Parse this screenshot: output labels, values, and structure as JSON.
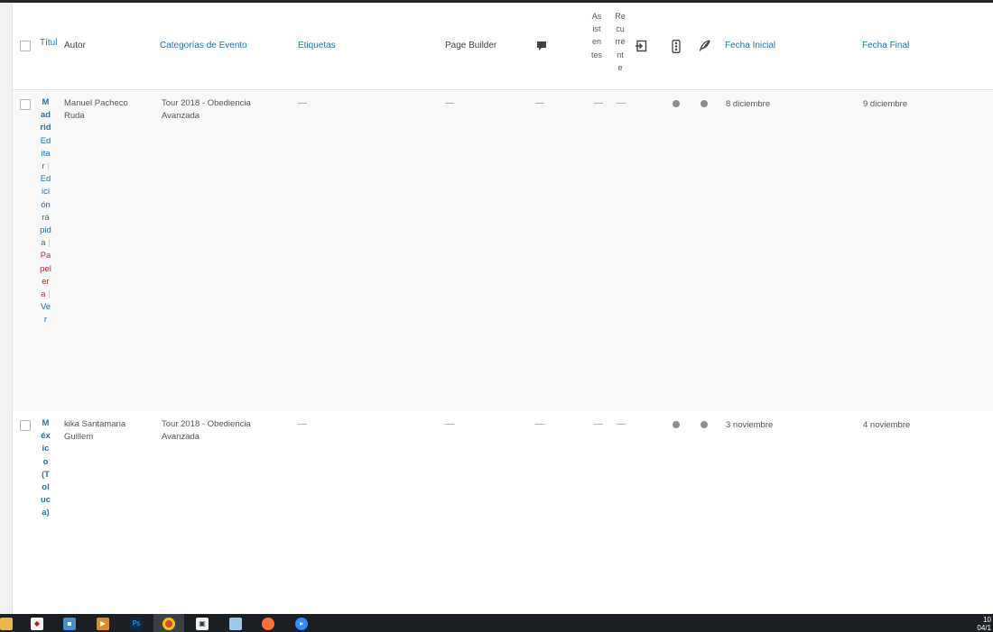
{
  "table": {
    "headers": {
      "title": "Títul",
      "author": "Autor",
      "categories": "Categorías de Evento",
      "tags": "Etiquetas",
      "page_builder": "Page Builder",
      "comments_icon": "comment-icon",
      "attendees": "Asistentes",
      "recurrent": "Recurrente",
      "export_icon": "export-icon",
      "traffic_icon": "traffic-light-icon",
      "feather_icon": "feather-icon",
      "start_date": "Fecha Inicial",
      "end_date": "Fecha Final"
    },
    "rows": [
      {
        "title": "Madrid",
        "actions": {
          "edit": "Editar",
          "sep1": "|",
          "quick_edit": "Edición rápida",
          "sep2": "|",
          "trash": "Papelera",
          "sep3": "|",
          "view": "Ver"
        },
        "author": "Manuel Pacheco Ruda",
        "category": "Tour 2018 - Obediencia Avanzada",
        "tags": "—",
        "page_builder": "—",
        "comments": "—",
        "attendees": "—",
        "recurrent": "—",
        "start_date": "8 diciembre",
        "end_date": "9 diciembre"
      },
      {
        "title": "México (Toluca)",
        "author": "kika Santamaria Guillem",
        "category": "Tour 2018 - Obediencia Avanzada",
        "tags": "—",
        "page_builder": "—",
        "comments": "—",
        "attendees": "—",
        "recurrent": "—",
        "start_date": "3 noviembre",
        "end_date": "4 noviembre"
      }
    ]
  },
  "taskbar": {
    "apps": [
      "file-explorer-icon",
      "acrobat-icon",
      "network-icon",
      "media-player-icon",
      "photoshop-icon",
      "chrome-icon",
      "store-icon",
      "notes-icon",
      "firefox-icon",
      "zoom-icon"
    ],
    "photoshop_label": "Ps",
    "clock_time": "10",
    "clock_date": "04/1"
  },
  "colors": {
    "link": "#2271b1",
    "trash": "#b32d2e",
    "taskbar": "#1b1f24",
    "header_bar": "#23282d"
  }
}
